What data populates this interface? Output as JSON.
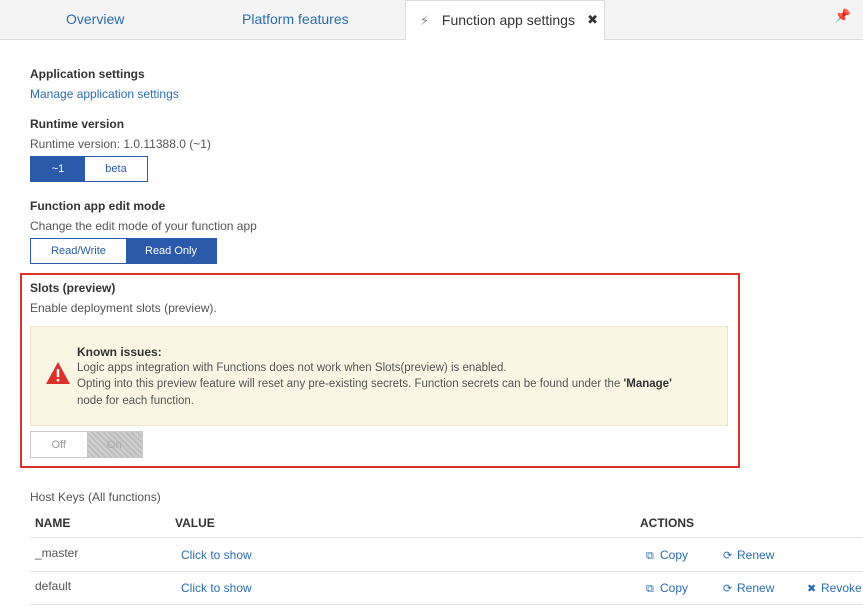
{
  "tabs": {
    "overview": "Overview",
    "platform": "Platform features",
    "active": "Function app settings"
  },
  "app_settings": {
    "title": "Application settings",
    "link": "Manage application settings"
  },
  "runtime": {
    "title": "Runtime version",
    "value": "Runtime version: 1.0.11388.0 (~1)",
    "options": [
      "~1",
      "beta"
    ],
    "selected": "~1"
  },
  "edit_mode": {
    "title": "Function app edit mode",
    "desc": "Change the edit mode of your function app",
    "options": [
      "Read/Write",
      "Read Only"
    ],
    "selected": "Read Only"
  },
  "slots": {
    "title": "Slots (preview)",
    "desc": "Enable deployment slots (preview).",
    "warning_title": "Known issues:",
    "warning_line1": "Logic apps integration with Functions does not work when Slots(preview) is enabled.",
    "warning_line2_pre": "Opting into this preview feature will reset any pre-existing secrets. Function secrets can be found under the ",
    "warning_line2_bold": "'Manage'",
    "warning_line3": "node for each function.",
    "toggle_off": "Off",
    "toggle_on": "On"
  },
  "host_keys": {
    "title": "Host Keys (All functions)",
    "headers": {
      "name": "NAME",
      "value": "VALUE",
      "actions": "ACTIONS"
    },
    "rows": [
      {
        "name": "_master",
        "value": "Click to show",
        "copy": "Copy",
        "renew": "Renew"
      },
      {
        "name": "default",
        "value": "Click to show",
        "copy": "Copy",
        "renew": "Renew",
        "revoke": "Revoke"
      }
    ]
  },
  "colors": {
    "accent": "#2b5aab",
    "link": "#2b6cb0",
    "highlight": "#d9322b",
    "warning_bg": "#faf6e3"
  }
}
